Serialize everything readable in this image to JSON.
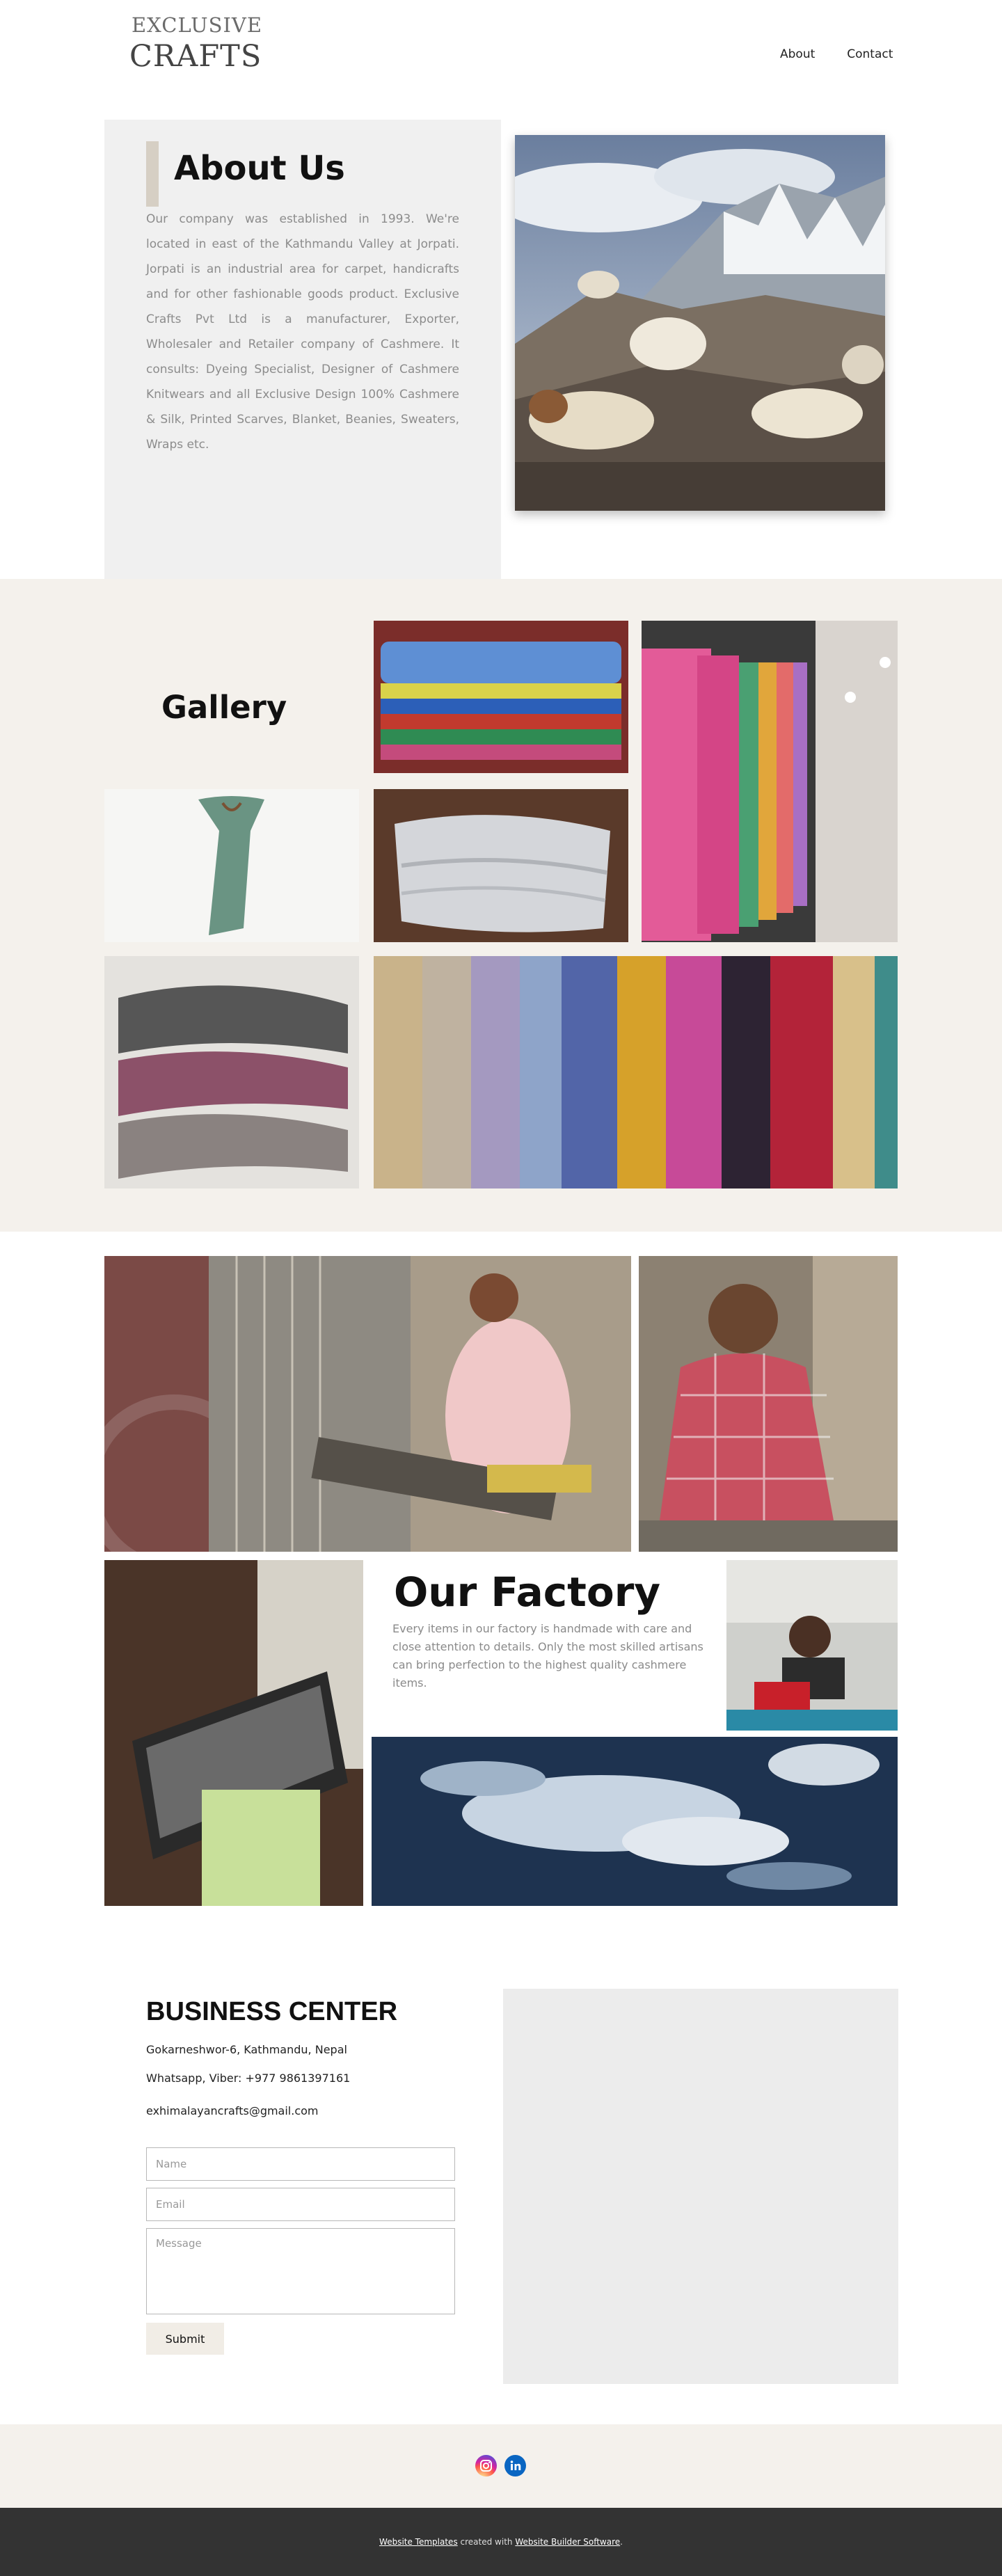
{
  "header": {
    "logo_line1": "EXCLUSIVE",
    "logo_line2": "CRAFTS",
    "nav": [
      {
        "label": "About"
      },
      {
        "label": "Contact"
      }
    ]
  },
  "about": {
    "title": "About Us",
    "text": "Our company was established in 1993. We're located in east of the Kathmandu Valley at Jorpati. Jorpati is an industrial area for carpet, handicrafts and for other fashionable goods product. Exclusive Crafts Pvt Ltd is a manufacturer, Exporter, Wholesaler and Retailer company of Cashmere. It consults: Dyeing Specialist, Designer of Cashmere Knitwears and all Exclusive Design  100% Cashmere & Silk, Printed Scarves, Blanket, Beanies, Sweaters, Wraps etc."
  },
  "gallery": {
    "title": "Gallery"
  },
  "factory": {
    "title": "Our Factory",
    "text": "Every items in our factory is handmade with care and close attention to details. Only the most skilled artisans can bring perfection to the highest quality cashmere items."
  },
  "business": {
    "title": "BUSINESS CENTER",
    "address": "Gokarneshwor-6, Kathmandu, Nepal",
    "phone": "Whatsapp, Viber: +977 9861397161",
    "email": "exhimalayancrafts@gmail.com",
    "form": {
      "name_placeholder": "Name",
      "email_placeholder": "Email",
      "message_placeholder": "Message",
      "submit_label": "Submit"
    }
  },
  "social": {
    "icons": [
      "instagram-icon",
      "linkedin-icon"
    ],
    "colors": {
      "instagram": "#d6249f",
      "linkedin": "#0a66c2"
    }
  },
  "footer": {
    "link1": "Website Templates",
    "middle": " created with ",
    "link2": "Website Builder Software",
    "end": "."
  },
  "colors": {
    "gallery_bg": "#f4f1ec",
    "about_panel": "#f0f0f0",
    "footer_bg": "#333333"
  }
}
